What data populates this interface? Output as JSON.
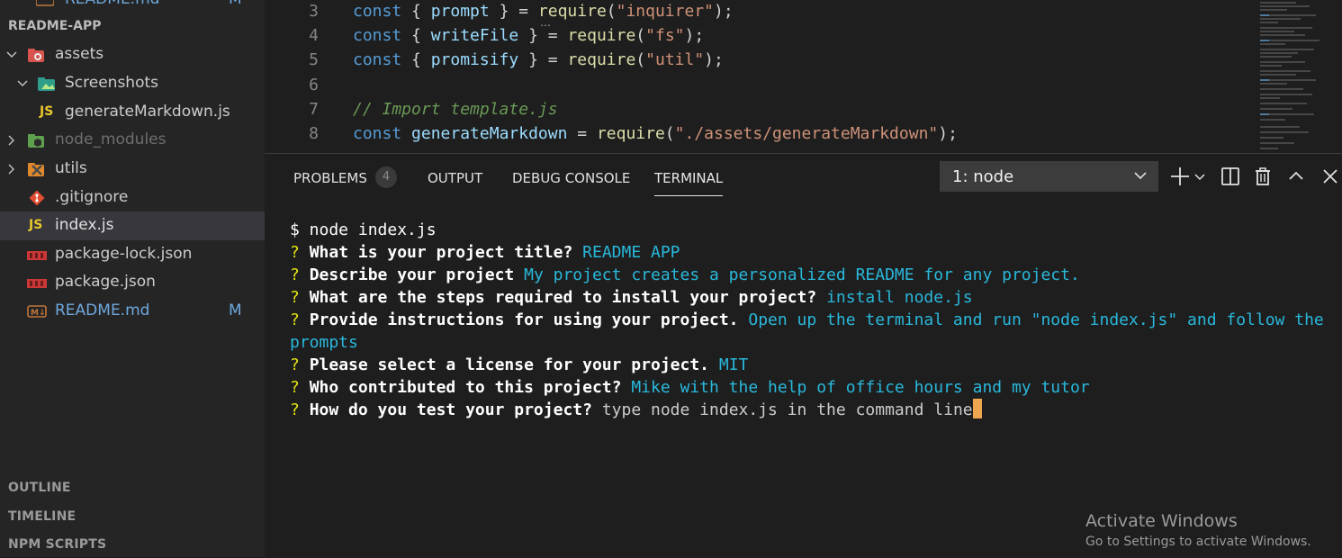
{
  "explorer": {
    "top_partial": {
      "label": "README.md",
      "status": "M"
    },
    "project_header": "README-APP",
    "items": [
      {
        "label": "assets",
        "type": "folder"
      },
      {
        "label": "Screenshots",
        "type": "folder"
      },
      {
        "label": "generateMarkdown.js",
        "type": "file-js",
        "icon_text": "JS"
      },
      {
        "label": "node_modules",
        "type": "folder"
      },
      {
        "label": "utils",
        "type": "folder"
      },
      {
        "label": ".gitignore",
        "type": "file-git"
      },
      {
        "label": "index.js",
        "type": "file-js",
        "icon_text": "JS",
        "selected": true
      },
      {
        "label": "package-lock.json",
        "type": "file-npm",
        "icon_text": "npm"
      },
      {
        "label": "package.json",
        "type": "file-npm",
        "icon_text": "npm"
      },
      {
        "label": "README.md",
        "type": "file-md",
        "icon_text": "M↓",
        "status": "M"
      }
    ],
    "sections": [
      "OUTLINE",
      "TIMELINE",
      "NPM SCRIPTS"
    ]
  },
  "editor": {
    "lines": [
      {
        "num": "3",
        "tokens": [
          [
            "kw",
            "const"
          ],
          [
            "pl",
            " { "
          ],
          [
            "var",
            "prompt"
          ],
          [
            "pl",
            " } = "
          ],
          [
            "fn",
            "require"
          ],
          [
            "pl",
            "("
          ],
          [
            "str",
            "\"inquirer\""
          ],
          [
            "pl",
            ");"
          ]
        ]
      },
      {
        "num": "4",
        "tokens": [
          [
            "kw",
            "const"
          ],
          [
            "pl",
            " { "
          ],
          [
            "var",
            "writeFile"
          ],
          [
            "pl",
            " } = "
          ],
          [
            "fn",
            "require"
          ],
          [
            "pl",
            "("
          ],
          [
            "str",
            "\"fs\""
          ],
          [
            "pl",
            ");"
          ]
        ]
      },
      {
        "num": "5",
        "tokens": [
          [
            "kw",
            "const"
          ],
          [
            "pl",
            " { "
          ],
          [
            "var",
            "promisify"
          ],
          [
            "pl",
            " } = "
          ],
          [
            "fn",
            "require"
          ],
          [
            "pl",
            "("
          ],
          [
            "str",
            "\"util\""
          ],
          [
            "pl",
            ");"
          ]
        ]
      },
      {
        "num": "6",
        "tokens": []
      },
      {
        "num": "7",
        "tokens": [
          [
            "cm",
            "// Import template.js"
          ]
        ]
      },
      {
        "num": "8",
        "tokens": [
          [
            "kw",
            "const"
          ],
          [
            "pl",
            " "
          ],
          [
            "var",
            "generateMarkdown"
          ],
          [
            "pl",
            " = "
          ],
          [
            "fn",
            "require"
          ],
          [
            "pl",
            "("
          ],
          [
            "str",
            "\"./assets/generateMarkdown\""
          ],
          [
            "pl",
            ");"
          ]
        ]
      }
    ]
  },
  "panel": {
    "tabs": [
      {
        "label": "PROBLEMS",
        "badge": "4"
      },
      {
        "label": "OUTPUT"
      },
      {
        "label": "DEBUG CONSOLE"
      },
      {
        "label": "TERMINAL",
        "active": true
      }
    ],
    "terminal_select": "1: node"
  },
  "terminal": {
    "command": "$ node index.js",
    "qa": [
      {
        "q": "What is your project title?",
        "a": "README APP"
      },
      {
        "q": "Describe your project",
        "a": "My project creates a personalized README for any project."
      },
      {
        "q": "What are the steps required to install your project?",
        "a": "install node.js"
      },
      {
        "q": "Provide instructions for using your project.",
        "a": "Open up the terminal and run \"node index.js\" and follow the prompts"
      },
      {
        "q": "Please select a license for your project.",
        "a": "MIT"
      },
      {
        "q": "Who contributed to this project?",
        "a": "Mike with the help of office hours and my tutor"
      }
    ],
    "current_prompt": "How do you test your project?",
    "current_input": "type node index.js in the command line"
  },
  "watermark": {
    "title": "Activate Windows",
    "subtitle": "Go to Settings to activate Windows."
  },
  "colors": {
    "accent_js": "#e8c72a",
    "cursor": "#f0a650",
    "answer": "#29b8db",
    "prompt_mark": "#e5e510"
  }
}
